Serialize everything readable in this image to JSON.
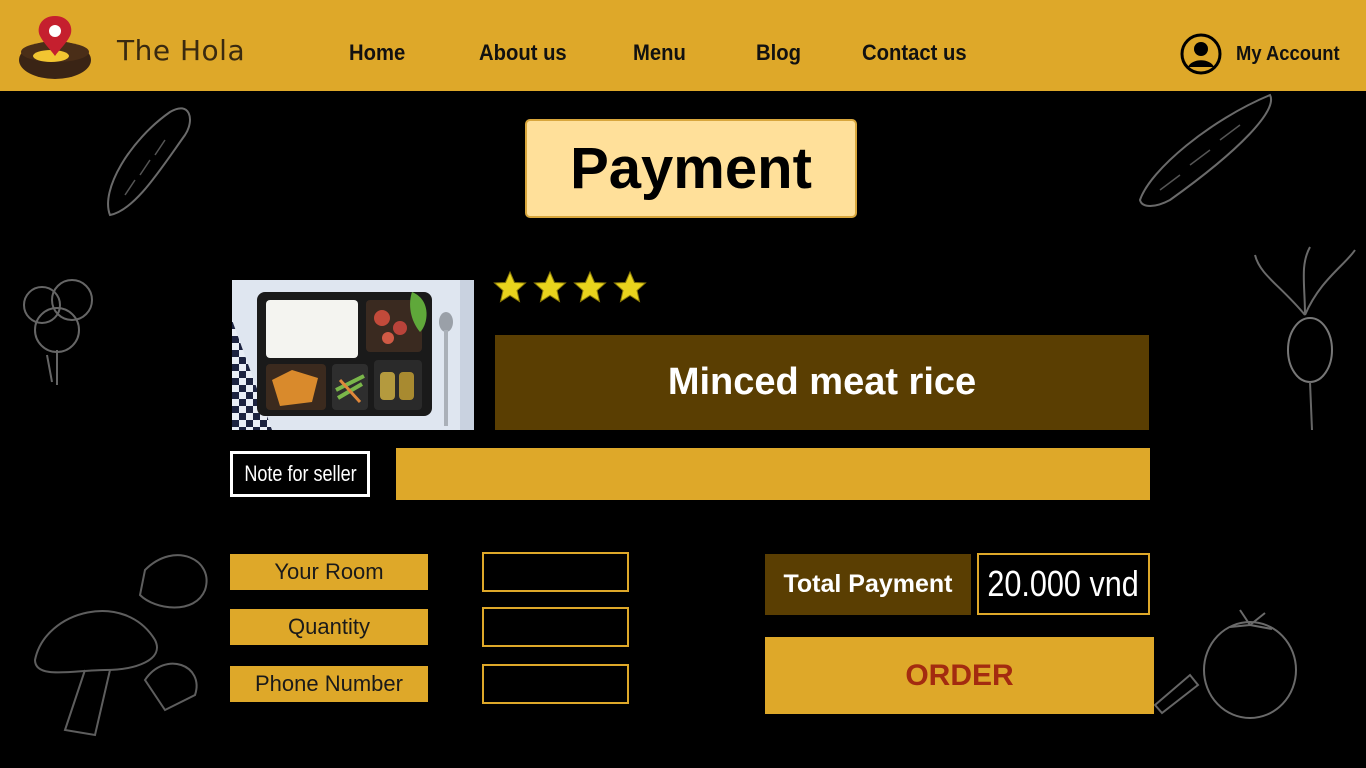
{
  "header": {
    "brand": "The Hola",
    "nav": [
      "Home",
      "About us",
      "Menu",
      "Blog",
      "Contact us"
    ],
    "account_label": "My Account"
  },
  "page": {
    "title": "Payment"
  },
  "product": {
    "name": "Minced meat rice",
    "rating": 4,
    "rating_max": 4
  },
  "note": {
    "label": "Note for seller",
    "value": ""
  },
  "form": {
    "room_label": "Your Room",
    "quantity_label": "Quantity",
    "phone_label": "Phone Number",
    "room_value": "",
    "quantity_value": "",
    "phone_value": ""
  },
  "summary": {
    "total_label": "Total Payment",
    "total_value": "20.000 vnd",
    "order_label": "ORDER"
  },
  "colors": {
    "accent": "#dea829",
    "dark_brown": "#5a3e02",
    "title_bg": "#ffe09a",
    "order_text": "#a32b10",
    "background": "#000000"
  },
  "icons": {
    "logo": "map-pin-bowl-logo",
    "account": "user-circle-icon",
    "rating": "star-icon"
  }
}
